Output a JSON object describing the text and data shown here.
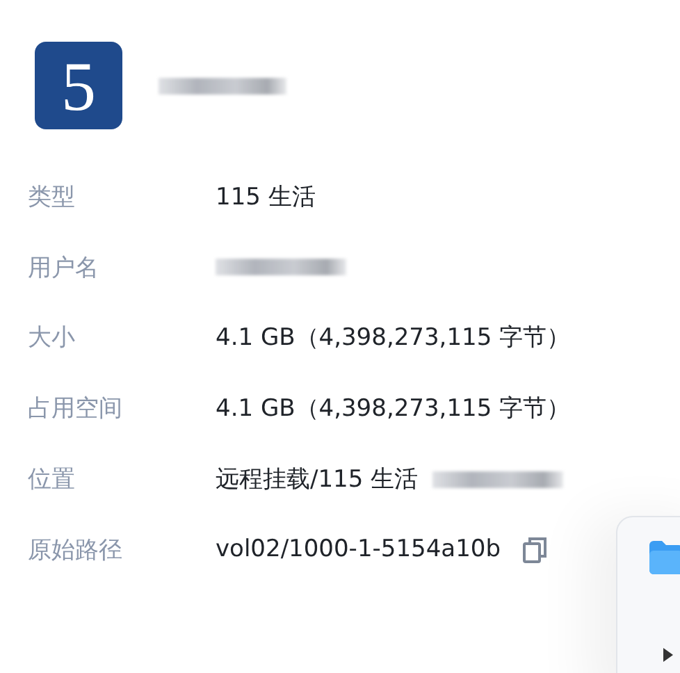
{
  "header": {
    "logo_text": "5",
    "name_redacted": true
  },
  "properties": [
    {
      "label": "类型",
      "value": "115 生活",
      "redacted": false,
      "copyable": false
    },
    {
      "label": "用户名",
      "redacted": true,
      "copyable": false
    },
    {
      "label": "大小",
      "value": "4.1 GB（4,398,273,115 字节）",
      "redacted": false,
      "copyable": false
    },
    {
      "label": "占用空间",
      "value": "4.1 GB（4,398,273,115 字节）",
      "redacted": false,
      "copyable": false
    },
    {
      "label": "位置",
      "value": "远程挂载/115 生活",
      "redacted": true,
      "copyable": false
    },
    {
      "label": "原始路径",
      "value": "vol02/1000-1-5154a10b",
      "redacted": false,
      "copyable": true
    }
  ],
  "side_card": {
    "visible": true
  }
}
